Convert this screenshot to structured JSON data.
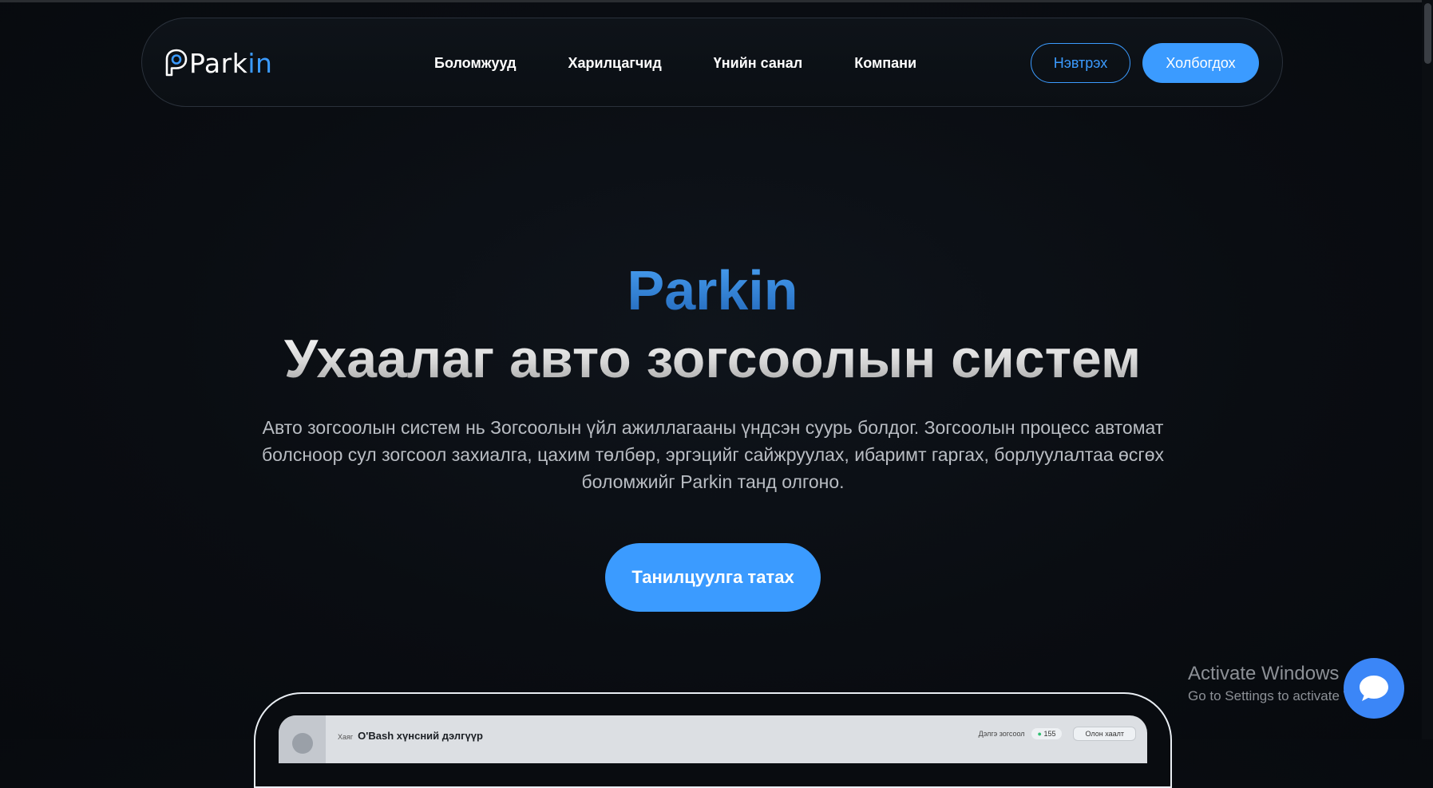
{
  "nav": {
    "logo_text_a": "Park",
    "logo_text_b": "in",
    "links": [
      "Боломжууд",
      "Харилцагчид",
      "Үнийн санал",
      "Компани"
    ],
    "login_label": "Нэвтрэх",
    "contact_label": "Холбогдох"
  },
  "hero": {
    "brand": "Parkin",
    "headline": "Ухаалаг авто зогсоолын систем",
    "description": "Авто зогсоолын систем нь Зогсоолын үйл ажиллагааны үндсэн суурь болдог. Зогсоолын процесс автомат болсноор сул зогсоол захиалга, цахим төлбөр, эргэцийг сайжруулах, ибаримт гаргах, борлуулалтаа өсгөх боломжийг Parkin танд олгоно.",
    "cta_label": "Танилцуулга татах"
  },
  "preview": {
    "label_small": "Хаяг",
    "title": "O'Bash хүнсний дэлгүүр",
    "stat_label": "Дэлгэ зогсоол",
    "badge": "155",
    "button": "Олон хаалт"
  },
  "os_overlay": {
    "activate_title": "Activate Windows",
    "activate_sub": "Go to Settings to activate Windows."
  },
  "colors": {
    "accent": "#3b9bff",
    "background": "#0a0d12",
    "brand_gradient_top": "#4aa2f5",
    "brand_gradient_bottom": "#2166b8",
    "chat_button": "#3b86f7"
  },
  "icons": {
    "logo": "parking-pin-logo-icon",
    "chat": "chat-bubble-icon"
  }
}
